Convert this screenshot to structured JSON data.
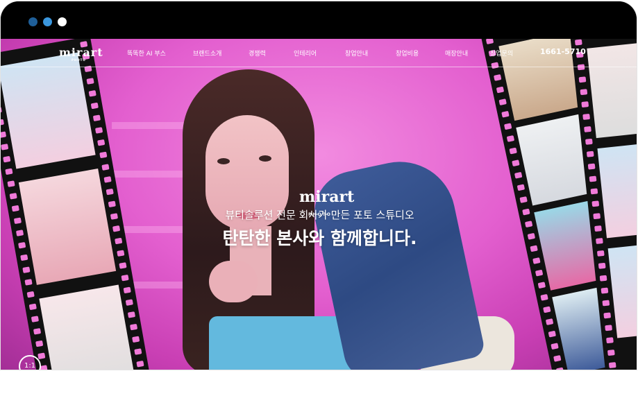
{
  "window": {
    "controls": [
      "close-dot",
      "minimize-dot",
      "maximize-dot"
    ]
  },
  "nav": {
    "logo_text": "mirart",
    "logo_sub": "PHOTO",
    "items": [
      {
        "label": "똑똑한 AI 부스"
      },
      {
        "label": "브랜드소개"
      },
      {
        "label": "경쟁력"
      },
      {
        "label": "인테리어"
      },
      {
        "label": "창업안내"
      },
      {
        "label": "창업비용"
      },
      {
        "label": "매장안내"
      },
      {
        "label": "창업문의"
      }
    ],
    "phone": "1661-5710"
  },
  "hero": {
    "logo_text": "mirart",
    "logo_sub": "PHOTO",
    "subtitle": "뷰티솔루션 전문 회사가 만든 포토 스튜디오",
    "headline": "탄탄한 본사와 함께합니다.",
    "ratio_badge": "1:1"
  },
  "colors": {
    "accent_pink": "#e35fcf",
    "film_black": "#111111",
    "text_white": "#ffffff"
  }
}
